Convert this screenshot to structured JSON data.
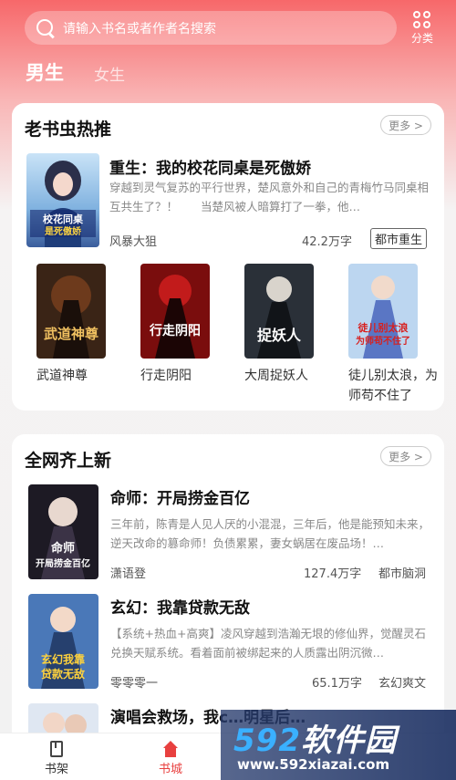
{
  "header": {
    "search_placeholder": "请输入书名或者作者名搜索",
    "category_label": "分类",
    "tabs": [
      {
        "label": "男生",
        "active": true
      },
      {
        "label": "女生",
        "active": false
      }
    ]
  },
  "section_recommend": {
    "title": "老书虫热推",
    "more_label": "更多 >",
    "featured": {
      "title": "重生：我的校花同桌是死傲娇",
      "description": "穿越到灵气复苏的平行世界，楚风意外和自己的青梅竹马同桌相互共生了？！　　当楚风被人暗算打了一拳，他…",
      "author": "风暴大狙",
      "word_count": "42.2万字",
      "tag": "都市重生",
      "cover_text": "重生:我的校花同桌是死傲娇"
    },
    "grid": [
      {
        "title": "武道神尊",
        "cover_text": "武道神尊"
      },
      {
        "title": "行走阴阳",
        "cover_text": "行走阴阳"
      },
      {
        "title": "大周捉妖人",
        "cover_text": "捉妖人"
      },
      {
        "title": "徒儿别太浪，为师苟不住了",
        "cover_text": "徒儿别太浪 为师苟不住了"
      }
    ]
  },
  "section_new": {
    "title": "全网齐上新",
    "more_label": "更多 >",
    "books": [
      {
        "title": "命师：开局捞金百亿",
        "description": "三年前，陈青是人见人厌的小混混，三年后，他是能预知未来，逆天改命的篡命师！负债累累，妻女蜗居在废品场！…",
        "author": "潇语登",
        "word_count": "127.4万字",
        "tag": "都市脑洞",
        "cover_text": "命师 开局捞金百亿"
      },
      {
        "title": "玄幻：我靠贷款无敌",
        "description": "【系统+热血+高爽】凌风穿越到浩瀚无垠的修仙界，觉醒灵石兑换天赋系统。看着面前被绑起来的人质露出阴沉微…",
        "author": "零零零一",
        "word_count": "65.1万字",
        "tag": "玄幻爽文",
        "cover_text": "玄幻我靠贷款无敌"
      },
      {
        "title": "演唱会救场，我c…明星后…",
        "cover_text": ""
      }
    ]
  },
  "bottom_nav": [
    {
      "label": "书架",
      "active": false
    },
    {
      "label": "书城",
      "active": true
    }
  ],
  "watermark": {
    "brand": "592软件园",
    "url": "www.592xiazai.com"
  },
  "colors": {
    "accent": "#e8403f",
    "header_top": "#f7686a"
  }
}
